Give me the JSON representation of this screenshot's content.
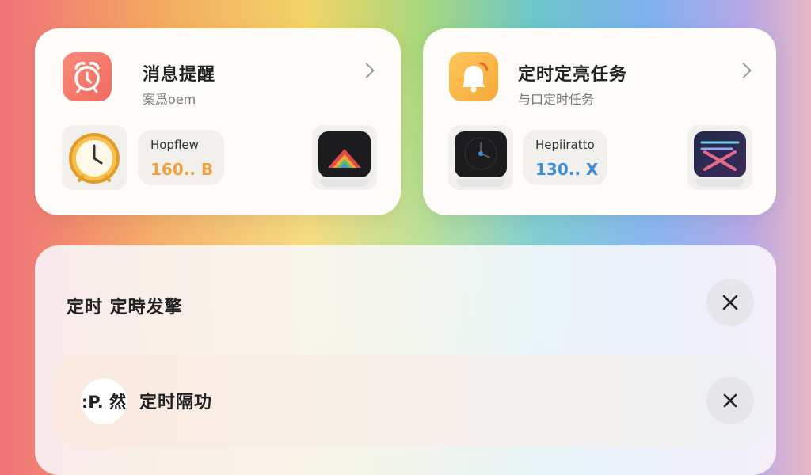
{
  "cards": [
    {
      "title": "消息提醒",
      "subtitle": "案爲oem",
      "stat_label": "Hopflew",
      "stat_value": "160.. B",
      "accent": "#f0a03a",
      "icon": "alarm-clock-icon"
    },
    {
      "title": "定时定亮任务",
      "subtitle": "与口定时任务",
      "stat_label": "Hepiiratto",
      "stat_value": "130.. X",
      "accent": "#3f8fd8",
      "icon": "bell-icon"
    }
  ],
  "panel": {
    "title": "定时 定時发擎",
    "row": {
      "badge": ":P. 然",
      "label": "定时隔功"
    }
  }
}
